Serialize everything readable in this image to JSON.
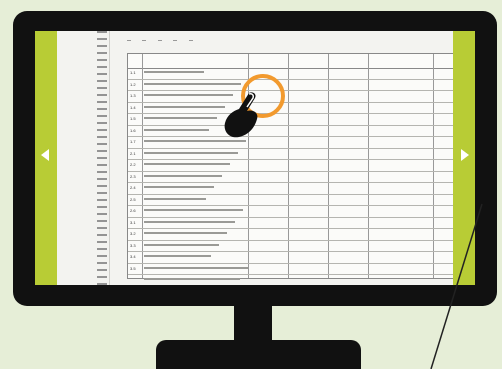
{
  "slideshow": {
    "prev_label": "previous slide",
    "next_label": "next slide",
    "accent_color": "#b8cc35",
    "highlight_color": "#f29a2e"
  },
  "document": {
    "header_cells": [
      "",
      "",
      "",
      "",
      ""
    ],
    "rows": [
      {
        "num": "1.1",
        "marks": "",
        "val": ""
      },
      {
        "num": "1.2",
        "marks": "",
        "val": ""
      },
      {
        "num": "1.3",
        "marks": "",
        "val": ""
      },
      {
        "num": "1.4",
        "marks": "",
        "val": ""
      },
      {
        "num": "1.5",
        "marks": "",
        "val": ""
      },
      {
        "num": "1.6",
        "marks": "",
        "val": ""
      },
      {
        "num": "1.7",
        "marks": "",
        "val": ""
      },
      {
        "num": "2.1",
        "marks": "",
        "val": ""
      },
      {
        "num": "2.2",
        "marks": "",
        "val": ""
      },
      {
        "num": "2.3",
        "marks": "",
        "val": ""
      },
      {
        "num": "2.4",
        "marks": "",
        "val": ""
      },
      {
        "num": "2.5",
        "marks": "",
        "val": ""
      },
      {
        "num": "2.6",
        "marks": "",
        "val": ""
      },
      {
        "num": "3.1",
        "marks": "",
        "val": ""
      },
      {
        "num": "3.2",
        "marks": "",
        "val": ""
      },
      {
        "num": "3.3",
        "marks": "",
        "val": ""
      },
      {
        "num": "3.4",
        "marks": "",
        "val": ""
      },
      {
        "num": "3.5",
        "marks": "",
        "val": ""
      },
      {
        "num": "",
        "marks": "",
        "val": ""
      },
      {
        "num": "",
        "marks": "",
        "val": ""
      }
    ]
  }
}
